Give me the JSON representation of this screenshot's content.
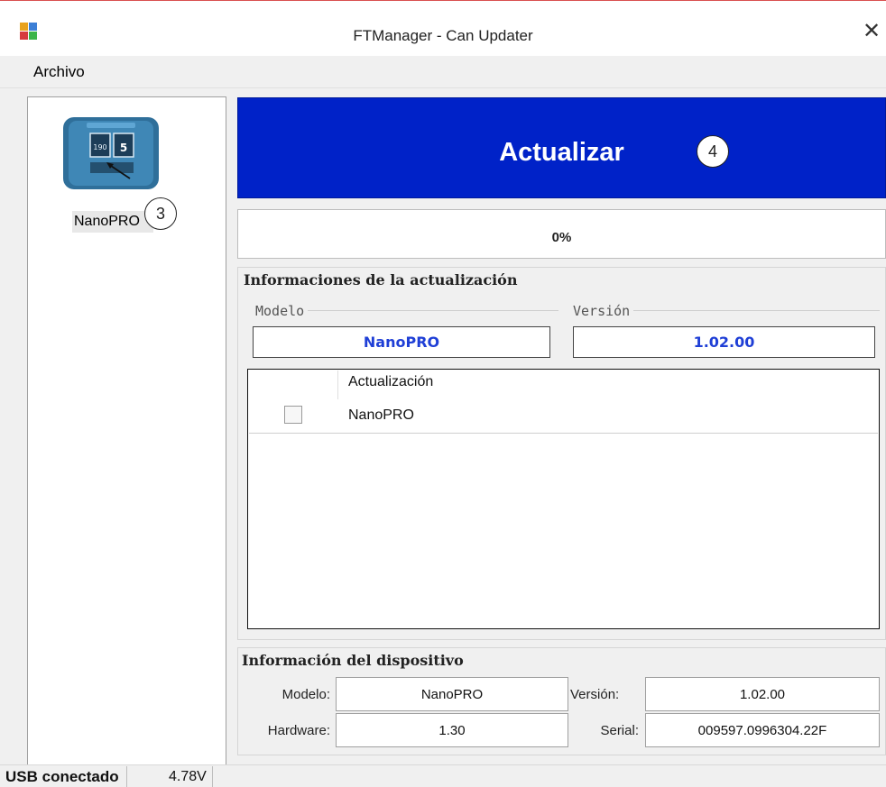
{
  "window": {
    "title": "FTManager - Can Updater",
    "close_glyph": "✕"
  },
  "menu": {
    "archivo": "Archivo"
  },
  "device_list": {
    "items": [
      {
        "label": "NanoPRO",
        "icon": "device-screen-icon"
      }
    ]
  },
  "callouts": {
    "three": "3",
    "four": "4"
  },
  "update_button": {
    "label": "Actualizar",
    "color": "#0022c8"
  },
  "progress": {
    "value": 0,
    "text": "0%"
  },
  "update_info": {
    "title": "Informaciones de la actualización",
    "modelo_legend": "Modelo",
    "version_legend": "Versión",
    "modelo_value": "NanoPRO",
    "version_value": "1.02.00",
    "table": {
      "column_header": "Actualización",
      "rows": [
        {
          "checked": false,
          "label": "NanoPRO"
        }
      ]
    }
  },
  "device_info": {
    "title": "Información del dispositivo",
    "modelo_label": "Modelo:",
    "modelo_value": "NanoPRO",
    "version_label": "Versión:",
    "version_value": "1.02.00",
    "hardware_label": "Hardware:",
    "hardware_value": "1.30",
    "serial_label": "Serial:",
    "serial_value": "009597.0996304.22F"
  },
  "status": {
    "connection": "USB conectado",
    "voltage": "4.78V"
  }
}
